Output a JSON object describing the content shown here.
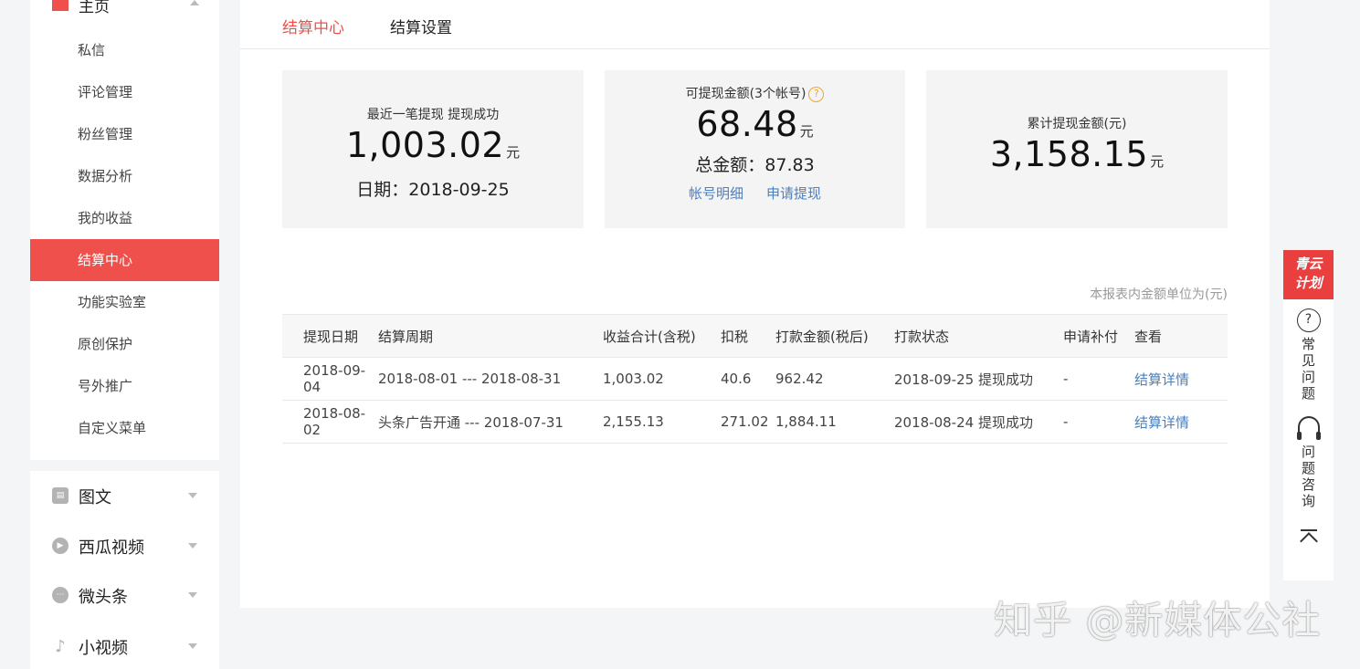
{
  "sidebar": {
    "home_label": "主页",
    "items": [
      {
        "label": "私信"
      },
      {
        "label": "评论管理"
      },
      {
        "label": "粉丝管理"
      },
      {
        "label": "数据分析"
      },
      {
        "label": "我的收益"
      },
      {
        "label": "结算中心",
        "active": true
      },
      {
        "label": "功能实验室"
      },
      {
        "label": "原创保护"
      },
      {
        "label": "号外推广"
      },
      {
        "label": "自定义菜单"
      }
    ],
    "groups": [
      {
        "label": "图文",
        "icon": "article-icon"
      },
      {
        "label": "西瓜视频",
        "icon": "video-play-icon"
      },
      {
        "label": "微头条",
        "icon": "chat-bubble-icon"
      },
      {
        "label": "小视频",
        "icon": "music-note-icon"
      }
    ]
  },
  "tabs": [
    {
      "label": "结算中心",
      "active": true
    },
    {
      "label": "结算设置",
      "active": false
    }
  ],
  "cards": {
    "last": {
      "title": "最近一笔提现 提现成功",
      "amount": "1,003.02",
      "unit": "元",
      "date": "日期：2018-09-25"
    },
    "available": {
      "title": "可提现金额(3个帐号)",
      "help": "?",
      "amount": "68.48",
      "unit": "元",
      "total": "总金额：87.83",
      "link1": "帐号明细",
      "link2": "申请提现"
    },
    "cumulative": {
      "title": "累计提现金额(元)",
      "amount": "3,158.15",
      "unit": "元"
    }
  },
  "table_note": "本报表内金额单位为(元)",
  "table": {
    "headers": [
      "提现日期",
      "结算周期",
      "收益合计(含税)",
      "扣税",
      "打款金额(税后)",
      "打款状态",
      "申请补付",
      "查看"
    ],
    "rows": [
      [
        "2018-09-04",
        "2018-08-01 --- 2018-08-31",
        "1,003.02",
        "40.6",
        "962.42",
        "2018-09-25 提现成功",
        "-",
        "结算详情"
      ],
      [
        "2018-08-02",
        "头条广告开通 --- 2018-07-31",
        "2,155.13",
        "271.02",
        "1,884.11",
        "2018-08-24 提现成功",
        "-",
        "结算详情"
      ]
    ]
  },
  "float_bar": {
    "badge_line1": "青云",
    "badge_line2": "计划",
    "faq_icon": "?",
    "faq_label": "常见问题",
    "consult_label": "问题咨询"
  },
  "watermark": "知乎 @新媒体公社",
  "colors": {
    "accent": "#f0504b",
    "link": "#4a7fc0",
    "help": "#f5a623"
  }
}
